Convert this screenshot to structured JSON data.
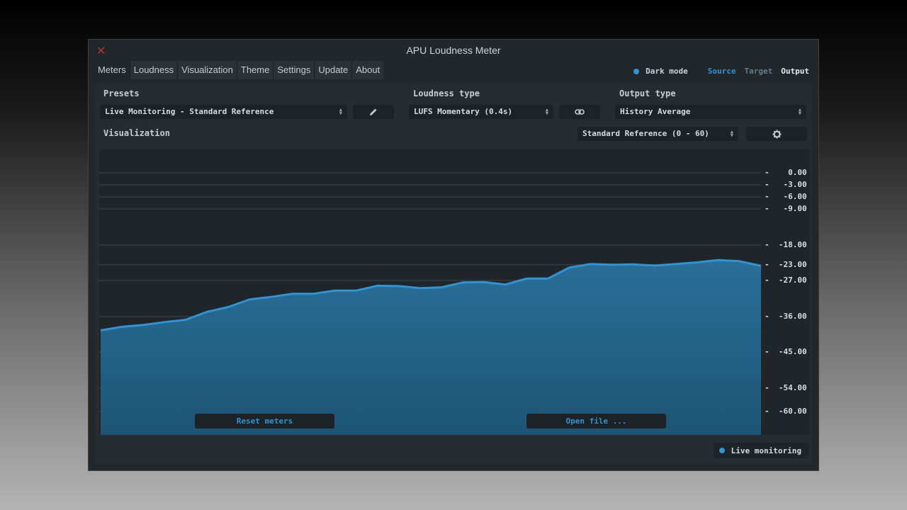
{
  "window": {
    "title": "APU Loudness Meter",
    "close_label": "✕"
  },
  "menu": [
    "Meters",
    "Loudness",
    "Visualization",
    "Theme",
    "Settings",
    "Update",
    "About"
  ],
  "topright": {
    "darkmode": "Dark mode",
    "source": "Source",
    "target": "Target",
    "output": "Output"
  },
  "presets": {
    "label": "Presets",
    "value": "Live Monitoring - Standard Reference"
  },
  "loudness_type": {
    "label": "Loudness type",
    "value": "LUFS Momentary (0.4s)"
  },
  "output_type": {
    "label": "Output type",
    "value": "History Average"
  },
  "visualization": {
    "label": "Visualization",
    "value": "Standard Reference (0 - 60)"
  },
  "buttons": {
    "reset": "Reset meters",
    "open": "Open file ..."
  },
  "live": {
    "label": "Live monitoring"
  },
  "colors": {
    "accent": "#2e94d6",
    "fill": "#235e80",
    "background": "#21272b"
  },
  "chart_data": {
    "type": "area",
    "y_ticks": [
      "0.00",
      "-3.00",
      "-6.00",
      "-9.00",
      "-18.00",
      "-23.00",
      "-27.00",
      "-36.00",
      "-45.00",
      "-54.00",
      "-60.00"
    ],
    "tick_values": [
      0,
      -3,
      -6,
      -9,
      -18,
      -23,
      -27,
      -36,
      -45,
      -54,
      -60
    ],
    "ylim": [
      -60,
      0
    ],
    "series": [
      {
        "values": [
          -39.5,
          -38.6,
          -38.1,
          -37.4,
          -36.8,
          -34.8,
          -33.6,
          -31.7,
          -31.1,
          -30.3,
          -30.3,
          -29.5,
          -29.5,
          -28.3,
          -28.4,
          -28.9,
          -28.7,
          -27.5,
          -27.4,
          -28.0,
          -26.5,
          -26.5,
          -23.7,
          -22.8,
          -23.0,
          -22.9,
          -23.2,
          -22.8,
          -22.4,
          -21.8,
          -22.1,
          -23.3
        ]
      }
    ]
  }
}
